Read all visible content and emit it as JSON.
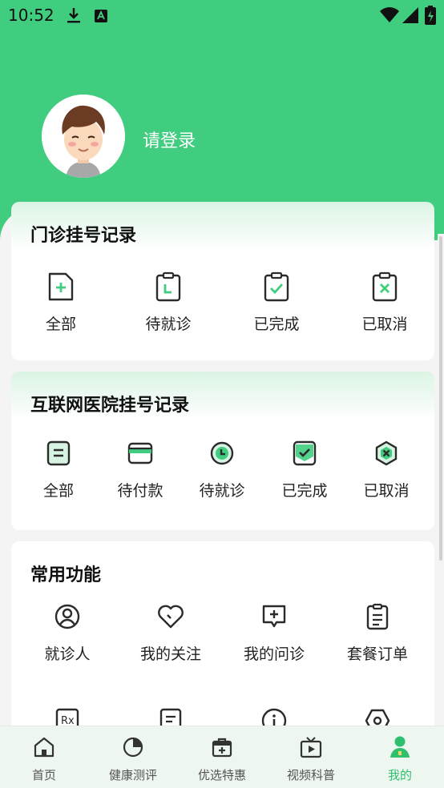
{
  "status_bar": {
    "time": "10:52"
  },
  "profile": {
    "login_text": "请登录"
  },
  "outpatient": {
    "title": "门诊挂号记录",
    "items": [
      {
        "label": "全部",
        "icon": "file-plus-icon"
      },
      {
        "label": "待就诊",
        "icon": "clipboard-clock-icon"
      },
      {
        "label": "已完成",
        "icon": "clipboard-check-icon"
      },
      {
        "label": "已取消",
        "icon": "clipboard-x-icon"
      }
    ]
  },
  "internet_hospital": {
    "title": "互联网医院挂号记录",
    "items": [
      {
        "label": "全部",
        "icon": "list-icon"
      },
      {
        "label": "待付款",
        "icon": "wallet-icon"
      },
      {
        "label": "待就诊",
        "icon": "clock-icon"
      },
      {
        "label": "已完成",
        "icon": "check-icon"
      },
      {
        "label": "已取消",
        "icon": "hexagon-x-icon"
      }
    ]
  },
  "common": {
    "title": "常用功能",
    "items": [
      {
        "label": "就诊人",
        "icon": "user-circle-icon"
      },
      {
        "label": "我的关注",
        "icon": "heart-icon"
      },
      {
        "label": "我的问诊",
        "icon": "chat-plus-icon"
      },
      {
        "label": "套餐订单",
        "icon": "clipboard-list-icon"
      }
    ],
    "row2_icons": [
      "rx-icon",
      "document-icon",
      "info-icon",
      "settings-icon"
    ]
  },
  "bottom_nav": [
    {
      "label": "首页",
      "icon": "home-icon"
    },
    {
      "label": "健康测评",
      "icon": "pie-chart-icon"
    },
    {
      "label": "优选特惠",
      "icon": "medical-box-icon"
    },
    {
      "label": "视频科普",
      "icon": "video-icon"
    },
    {
      "label": "我的",
      "icon": "user-icon",
      "active": true
    }
  ],
  "colors": {
    "accent": "#40cd7f",
    "active_nav": "#2fc06e"
  }
}
